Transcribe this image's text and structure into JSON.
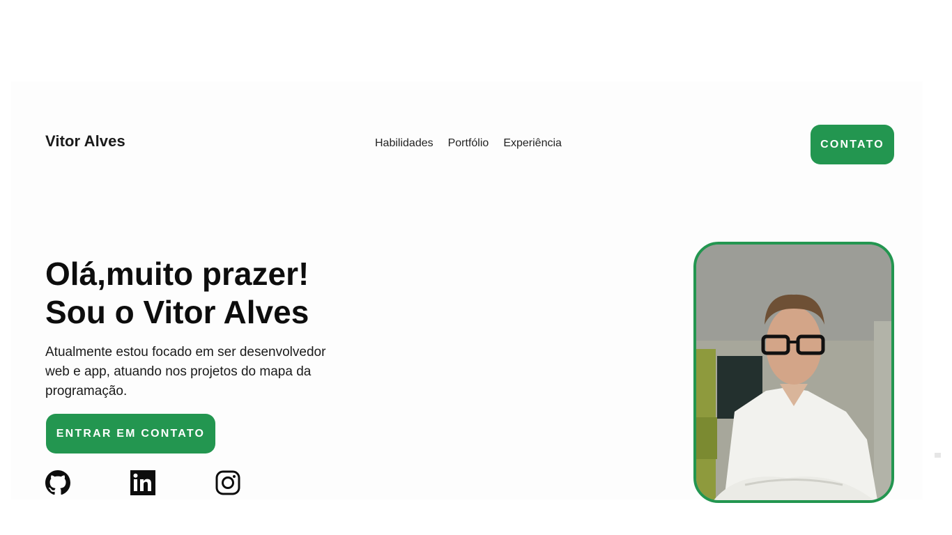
{
  "header": {
    "logo": "Vitor Alves",
    "nav": [
      {
        "label": "Habilidades"
      },
      {
        "label": "Portfólio"
      },
      {
        "label": "Experiência"
      }
    ],
    "contact_button": "CONTATO"
  },
  "hero": {
    "title_line1": "Olá,muito prazer!",
    "title_line2": "Sou o Vitor Alves",
    "description": "Atualmente estou focado em ser desenvolvedor web e app, atuando nos projetos do mapa da programação.",
    "cta_button": "ENTRAR EM CONTATO"
  },
  "socials": [
    {
      "icon": "github-icon"
    },
    {
      "icon": "linkedin-icon"
    },
    {
      "icon": "instagram-icon"
    }
  ],
  "colors": {
    "accent": "#239650",
    "text": "#111111",
    "panel": "#fdfdfd"
  }
}
